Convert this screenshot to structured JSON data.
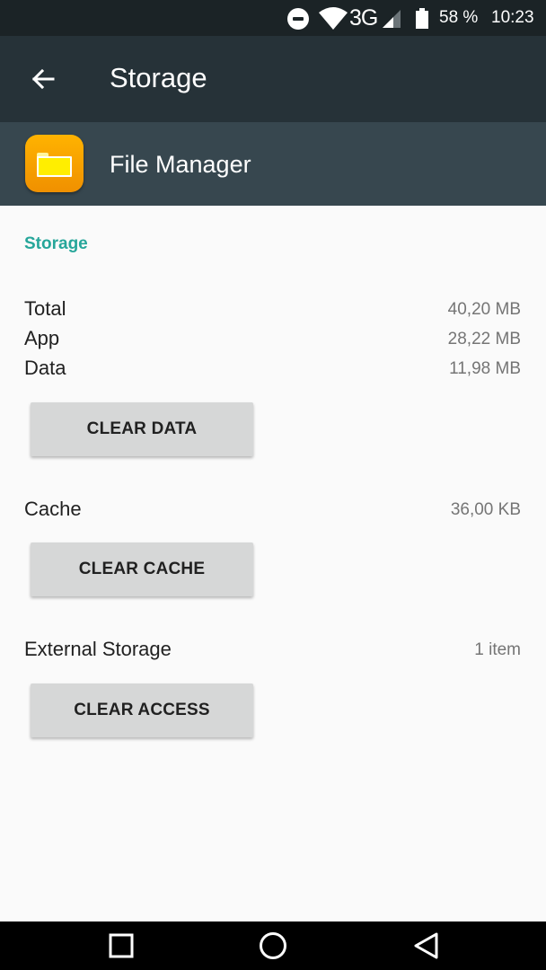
{
  "status_bar": {
    "network": "3G",
    "battery": "58 %",
    "time": "10:23"
  },
  "toolbar": {
    "title": "Storage"
  },
  "app": {
    "name": "File Manager"
  },
  "storage": {
    "section_title": "Storage",
    "total_label": "Total",
    "total_value": "40,20 MB",
    "app_label": "App",
    "app_value": "28,22 MB",
    "data_label": "Data",
    "data_value": "11,98 MB",
    "clear_data_label": "CLEAR DATA"
  },
  "cache": {
    "label": "Cache",
    "value": "36,00 KB",
    "clear_cache_label": "CLEAR CACHE"
  },
  "external_storage": {
    "label": "External Storage",
    "value": "1 item",
    "clear_access_label": "CLEAR ACCESS"
  },
  "colors": {
    "status_bar": "#1b2326",
    "toolbar": "#263238",
    "app_header": "#37474f",
    "accent": "#26a69a",
    "button": "#d6d7d7",
    "background": "#fafafa"
  }
}
